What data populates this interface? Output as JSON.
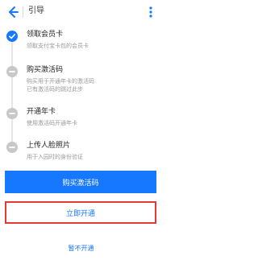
{
  "header": {
    "back_icon": "arrow-left-icon",
    "title": "引导",
    "more_icon": "more-vertical-icon"
  },
  "steps": [
    {
      "title": "领取会员卡",
      "desc": [
        "领取支付宝卡包的会员卡"
      ],
      "status": "done",
      "icon": "check-circle-icon"
    },
    {
      "title": "购买激活码",
      "desc": [
        "购买用于开通年卡的激活码",
        "已有激活码的跳过此步"
      ],
      "status": "pending",
      "icon": "minus-circle-icon"
    },
    {
      "title": "开通年卡",
      "desc": [
        "使用激活码开通年卡"
      ],
      "status": "pending",
      "icon": "minus-circle-icon"
    },
    {
      "title": "上传人脸照片",
      "desc": [
        "用于入园时的身份验证"
      ],
      "status": "pending",
      "icon": "minus-circle-icon"
    }
  ],
  "actions": {
    "buy_label": "购买激活码",
    "open_label": "立即开通",
    "skip_label": "暂不开通"
  },
  "colors": {
    "accent": "#1677ff",
    "highlight": "#e53935",
    "pending": "#c8c8c8"
  }
}
